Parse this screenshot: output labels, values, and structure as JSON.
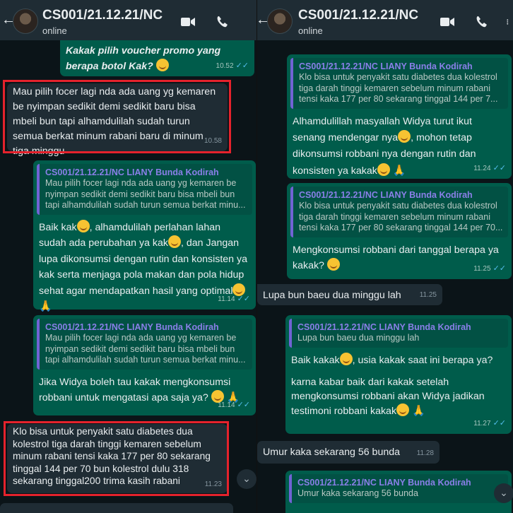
{
  "left": {
    "header": {
      "title": "CS001/21.12.21/NC",
      "status": "online"
    },
    "top_bubble": {
      "text": "Kakak pilih voucher promo yang berapa botol Kak?",
      "time": "10.52"
    },
    "msg1": {
      "text": "Mau pilih focer lagi nda ada uang yg kemaren be nyimpan sedikit demi sedikit baru bisa mbeli bun tapi alhamdulilah sudah turun semua berkat minum rabani baru di minum tiga minggu",
      "time": "10.58"
    },
    "reply1": {
      "quote_name": "CS001/21.12.21/NC LIANY Bunda Kodirah",
      "quote_text": "Mau pilih focer lagi nda ada uang yg kemaren be nyimpan sedikit demi sedikit baru bisa mbeli bun tapi alhamdulilah sudah turun semua berkat minu...",
      "text_a": "Baik kak",
      "text_b": ", alhamdulilah perlahan lahan sudah ada perubahan ya kak",
      "text_c": ", dan Jangan lupa dikonsumsi dengan rutin dan konsisten ya kak serta menjaga pola makan dan pola hidup sehat agar mendapatkan hasil yang optimal",
      "time": "11.14"
    },
    "reply2": {
      "quote_name": "CS001/21.12.21/NC LIANY Bunda Kodirah",
      "quote_text": "Mau pilih focer lagi nda ada uang yg kemaren be nyimpan sedikit demi sedikit baru bisa mbeli bun tapi alhamdulilah sudah turun semua berkat minu...",
      "text": "Jika Widya boleh tau kakak mengkonsumsi robbani untuk mengatasi apa saja ya?",
      "time": "11.14"
    },
    "msg2": {
      "text": "Klo bisa untuk penyakit satu diabetes dua kolestrol tiga darah tinggi kemaren sebelum minum rabani tensi kaka 177 per 80 sekarang tinggal 144 per 70 bun kolestrol dulu 318 sekarang tinggal200 trima kasih rabani",
      "time": "11.23"
    }
  },
  "right": {
    "header": {
      "title": "CS001/21.12.21/NC",
      "status": "online"
    },
    "reply1": {
      "quote_name": "CS001/21.12.21/NC LIANY Bunda Kodirah",
      "quote_text": "Klo bisa untuk penyakit satu diabetes dua kolestrol tiga darah tinggi kemaren sebelum minum rabani tensi kaka 177 per 80 sekarang tinggal 144 per 7...",
      "text_a": "Alhamdulillah masyallah Widya turut ikut senang mendengar nya",
      "text_b": ", mohon tetap dikonsumsi robbani nya dengan rutin dan konsisten ya kakak",
      "time": "11.24"
    },
    "reply2": {
      "quote_name": "CS001/21.12.21/NC LIANY Bunda Kodirah",
      "quote_text": "Klo bisa untuk penyakit satu diabetes dua kolestrol tiga darah tinggi kemaren sebelum minum rabani tensi kaka 177 per 80 sekarang tinggal 144 per 70...",
      "text": "Mengkonsumsi robbani dari tanggal berapa ya kakak?",
      "time": "11.25"
    },
    "msg1": {
      "text": "Lupa bun baeu dua minggu lah",
      "time": "11.25"
    },
    "reply3": {
      "quote_name": "CS001/21.12.21/NC LIANY Bunda Kodirah",
      "quote_text": "Lupa bun baeu dua minggu lah",
      "text_a": "Baik kakak",
      "text_b": ", usia kakak saat ini berapa ya?",
      "text_c": "karna kabar baik dari kakak setelah mengkonsumsi robbani akan Widya jadikan testimoni robbani kakak",
      "time": "11.27"
    },
    "msg2": {
      "text": "Umur kaka sekarang 56 bunda",
      "time": "11.28"
    },
    "reply4": {
      "quote_name": "CS001/21.12.21/NC LIANY Bunda Kodirah",
      "quote_text": "Umur kaka sekarang 56 bunda"
    }
  },
  "icons": [
    "back-arrow-icon",
    "video-call-icon",
    "phone-call-icon",
    "scroll-down-icon",
    "smile-emoji-icon",
    "pray-emoji-icon"
  ]
}
